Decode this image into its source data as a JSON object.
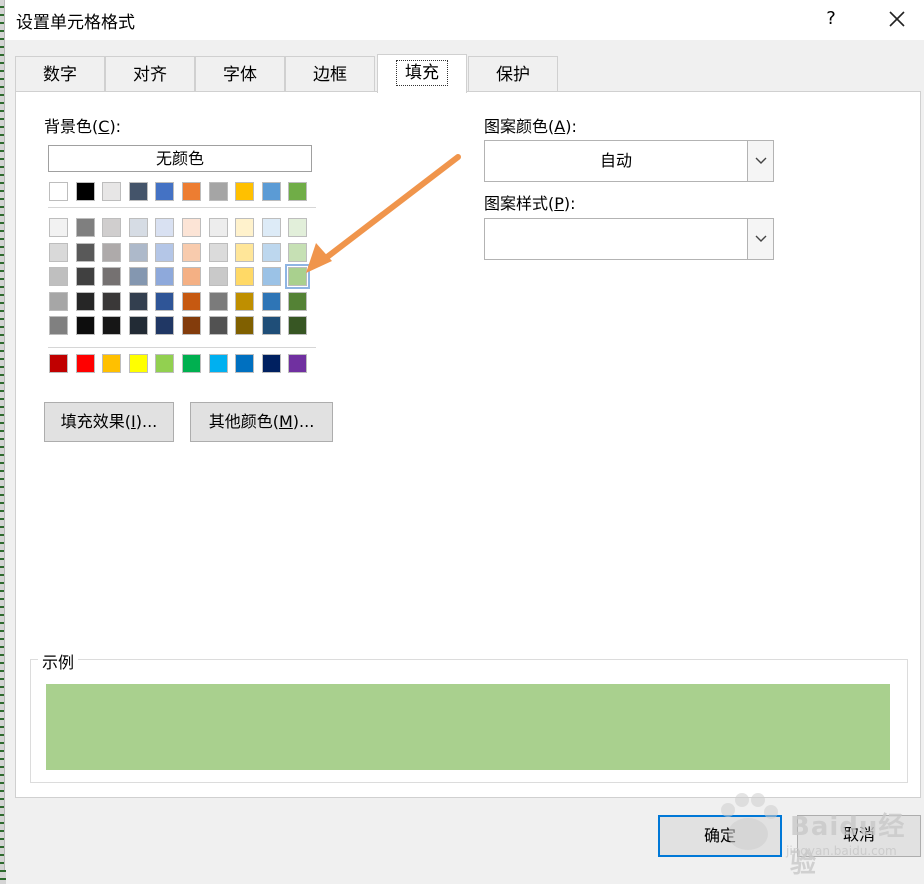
{
  "title": "设置单元格格式",
  "help_label": "?",
  "tabs": [
    "数字",
    "对齐",
    "字体",
    "边框",
    "填充",
    "保护"
  ],
  "active_tab": 4,
  "background": {
    "label": "背景色",
    "accel": "C",
    "colon": "):",
    "no_color_label": "无颜色",
    "theme_top": [
      "#ffffff",
      "#000000",
      "#e7e6e6",
      "#44546a",
      "#4472c4",
      "#ed7d31",
      "#a5a5a5",
      "#ffc000",
      "#5b9bd5",
      "#70ad47"
    ],
    "theme_grid": [
      [
        "#f2f2f2",
        "#7f7f7f",
        "#d0cece",
        "#d6dce4",
        "#d9e1f2",
        "#fce4d6",
        "#ededed",
        "#fff2cc",
        "#ddebf7",
        "#e2efda"
      ],
      [
        "#d9d9d9",
        "#595959",
        "#aeaaaa",
        "#adb9ca",
        "#b4c6e7",
        "#f8cbad",
        "#dbdbdb",
        "#ffe699",
        "#bdd7ee",
        "#c6e0b4"
      ],
      [
        "#bfbfbf",
        "#404040",
        "#757171",
        "#8497b0",
        "#8ea9db",
        "#f4b084",
        "#c9c9c9",
        "#ffd966",
        "#9bc2e6",
        "#a9d08e"
      ],
      [
        "#a6a6a6",
        "#262626",
        "#3a3838",
        "#333f4f",
        "#2f5597",
        "#c65911",
        "#7b7b7b",
        "#bf8f00",
        "#2e75b6",
        "#548235"
      ],
      [
        "#808080",
        "#0d0d0d",
        "#161616",
        "#222b35",
        "#203764",
        "#833c0c",
        "#525252",
        "#806000",
        "#1f4e78",
        "#375623"
      ]
    ],
    "standard": [
      "#c00000",
      "#ff0000",
      "#ffc000",
      "#ffff00",
      "#92d050",
      "#00b050",
      "#00b0f0",
      "#0070c0",
      "#002060",
      "#7030a0"
    ],
    "selected": {
      "row": 2,
      "col": 9
    }
  },
  "fill_effects_label": "填充效果",
  "fill_effects_accel": "I",
  "more_colors_label": "其他颜色",
  "more_colors_accel": "M",
  "ellipsis_close": ")...",
  "open_paren": "(",
  "pattern_color": {
    "label": "图案颜色",
    "accel": "A",
    "value": "自动"
  },
  "pattern_style": {
    "label": "图案样式",
    "accel": "P",
    "value": ""
  },
  "sample_label": "示例",
  "sample_color": "#a9d08e",
  "ok_label": "确定",
  "cancel_label": "取消",
  "annotation_arrow_color": "#f0954c",
  "watermark_text": "Baidu经验",
  "watermark_sub": "jingyan.baidu.com"
}
